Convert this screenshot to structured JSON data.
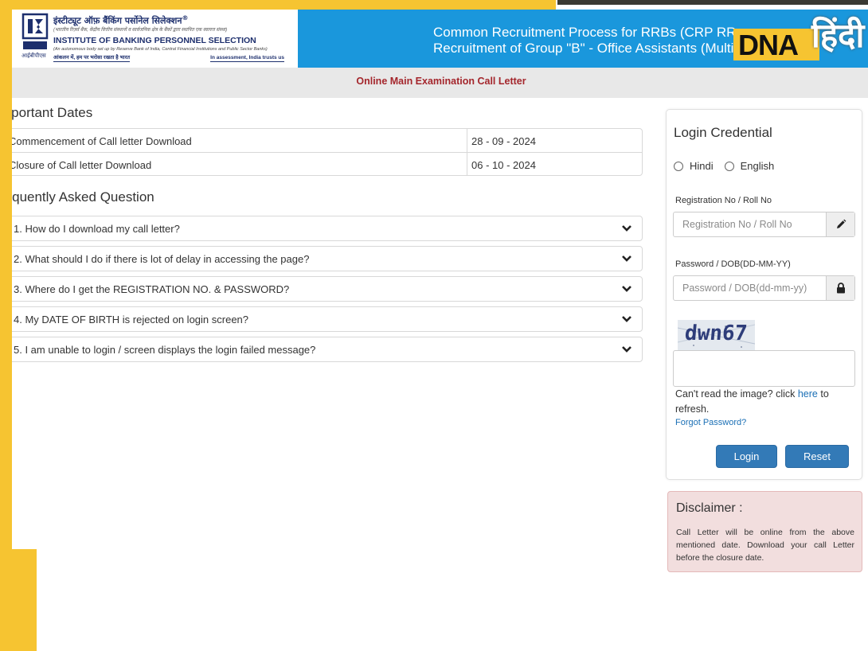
{
  "header": {
    "hindi_name": "इंस्टीट्यूट ऑफ़ बैंकिंग पर्सोनेल सिलेक्शन",
    "hindi_tagline": "(भारतीय रिज़र्व बैंक, केंद्रीय वित्तीय संस्थानों व सार्वजनिक क्षेत्र के बैंकों द्वारा स्थापित एक स्वायत्त संस्था)",
    "name": "INSTITUTE OF BANKING PERSONNEL SELECTION",
    "tagline": "(An autonomous body set up by Reserve Bank of India, Central Financial Institutions and Public Sector Banks)",
    "motto_hindi": "आंकलन में, हम पर भरोसा रखता है भारत",
    "motto_english": "In assessment, India trusts us",
    "logo_abbr": "IBPS",
    "logo_hindi": "आईबीपीएस",
    "banner_line1": "Common Recruitment Process for RRBs (CRP RR",
    "banner_line2": "Recruitment of Group \"B\" - Office Assistants (Multi"
  },
  "watermark": {
    "latin": "DNA",
    "hindi": "हिंदी"
  },
  "subheader": {
    "title": "Online Main Examination Call Letter"
  },
  "important_dates": {
    "title": "mportant Dates",
    "rows": [
      {
        "label": "Commencement of Call letter Download",
        "value": "28 - 09 - 2024"
      },
      {
        "label": "Closure of Call letter Download",
        "value": "06 - 10 - 2024"
      }
    ]
  },
  "faq": {
    "title": "requently Asked Question",
    "items": [
      "1. How do I download my call letter?",
      "2. What should I do if there is lot of delay in accessing the page?",
      "3. Where do I get the REGISTRATION NO. & PASSWORD?",
      "4. My DATE OF BIRTH is rejected on login screen?",
      "5. I am unable to login / screen displays the login failed message?"
    ]
  },
  "login": {
    "title": "Login Credential",
    "lang_hindi": "Hindi",
    "lang_english": "English",
    "reg_label": "Registration No / Roll No",
    "reg_placeholder": "Registration No / Roll No",
    "pwd_label": "Password / DOB(DD-MM-YY)",
    "pwd_placeholder": "Password / DOB(dd-mm-yy)",
    "captcha_text": "dwn67",
    "captcha_help_pre": "Can't read the image? click ",
    "captcha_help_link": "here",
    "captcha_help_post": " to refresh.",
    "forgot": "Forgot Password?",
    "login_button": "Login",
    "reset_button": "Reset"
  },
  "disclaimer": {
    "title": "Disclaimer :",
    "body": "Call Letter will be online from the above mentioned date. Download your call Letter before the closure date."
  },
  "colors": {
    "frame": "#f6c431",
    "banner": "#1a97dc",
    "subheader_text": "#a4262c",
    "button": "#337ab7",
    "disclaimer_bg": "#f2dede"
  }
}
